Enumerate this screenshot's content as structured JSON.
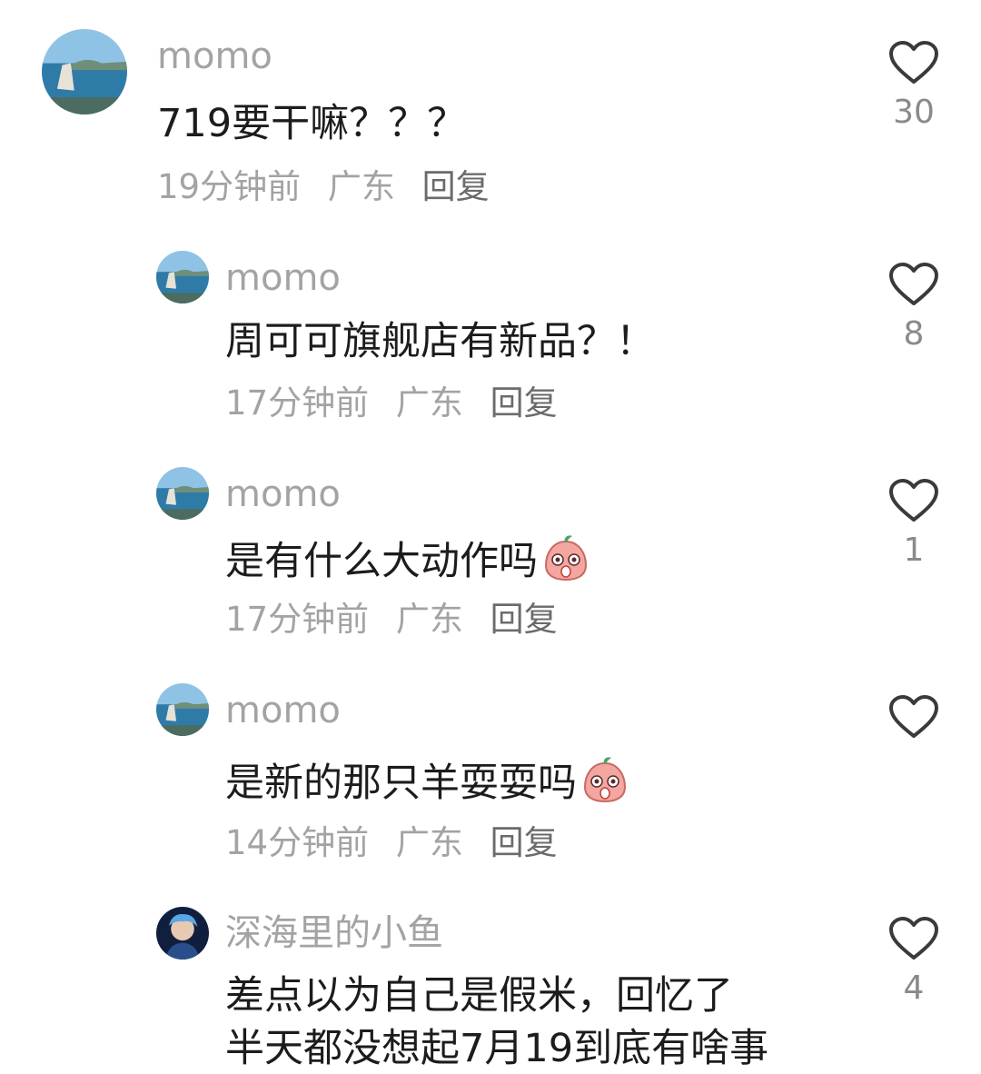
{
  "comments": [
    {
      "name": "momo",
      "text": "719要干嘛？？？",
      "time": "19分钟前",
      "location": "广东",
      "reply": "回复",
      "likes": "30"
    },
    {
      "name": "momo",
      "text": "周可可旗舰店有新品？！",
      "time": "17分钟前",
      "location": "广东",
      "reply": "回复",
      "likes": "8"
    },
    {
      "name": "momo",
      "text": "是有什么大动作吗",
      "time": "17分钟前",
      "location": "广东",
      "reply": "回复",
      "likes": "1",
      "emoji": "surprised-peach-emoji"
    },
    {
      "name": "momo",
      "text": "是新的那只羊耍耍吗",
      "time": "14分钟前",
      "location": "广东",
      "reply": "回复",
      "likes": "",
      "emoji": "surprised-peach-emoji"
    },
    {
      "name": "深海里的小鱼",
      "text": "差点以为自己是假米，回忆了",
      "text2": "半天都没想起7月19到底有啥事",
      "likes": "4"
    }
  ],
  "colors": {
    "heart": "#3a3a3a",
    "name": "#a3a3a3",
    "text": "#1c1c1c"
  }
}
